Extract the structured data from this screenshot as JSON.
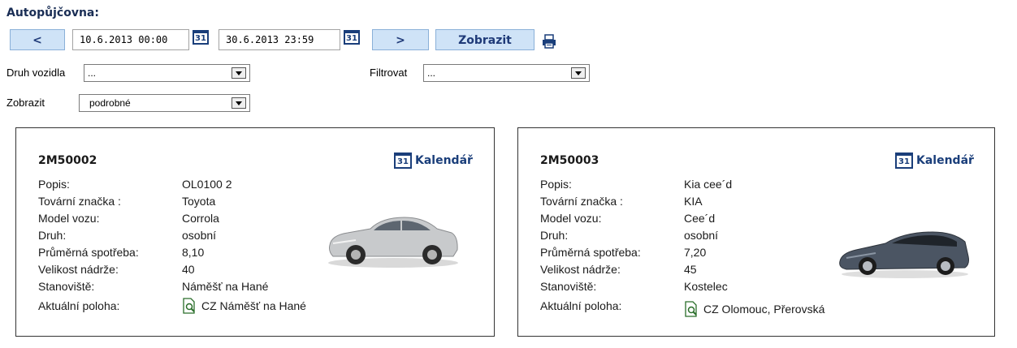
{
  "page": {
    "title": "Autopůjčovna:"
  },
  "toolbar": {
    "prev_label": "<",
    "date_from": "10.6.2013 00:00",
    "date_to": "30.6.2013 23:59",
    "next_label": ">",
    "show_label": "Zobrazit",
    "calendar_icon_text": "31"
  },
  "filters": {
    "vehicle_type_label": "Druh vozidla",
    "vehicle_type_value": "...",
    "filter_label": "Filtrovat",
    "filter_value": "...",
    "display_label": "Zobrazit",
    "display_value": "podrobné"
  },
  "field_labels": {
    "popis": "Popis:",
    "znacka": "Tovární značka :",
    "model": "Model vozu:",
    "druh": "Druh:",
    "spotreba": "Průměrná spotřeba:",
    "nadrz": "Velikost nádrže:",
    "stanoviste": "Stanoviště:",
    "poloha": "Aktuální poloha:"
  },
  "calendar_link": "Kalendář",
  "vehicles": [
    {
      "id": "2M50002",
      "popis": "OL0100 2",
      "znacka": "Toyota",
      "model": "Corrola",
      "druh": "osobní",
      "spotreba": "8,10",
      "nadrz": "40",
      "stanoviste": "Náměšť na Hané",
      "poloha": "CZ Náměšť na Hané",
      "car_color": "#c8cacc"
    },
    {
      "id": "2M50003",
      "popis": "Kia cee´d",
      "znacka": "KIA",
      "model": "Cee´d",
      "druh": "osobní",
      "spotreba": "7,20",
      "nadrz": "45",
      "stanoviste": "Kostelec",
      "poloha": "CZ Olomouc, Přerovská",
      "car_color": "#4b5563"
    }
  ],
  "colors": {
    "accent": "#1a3e7a",
    "button_bg": "#cfe3f7"
  }
}
